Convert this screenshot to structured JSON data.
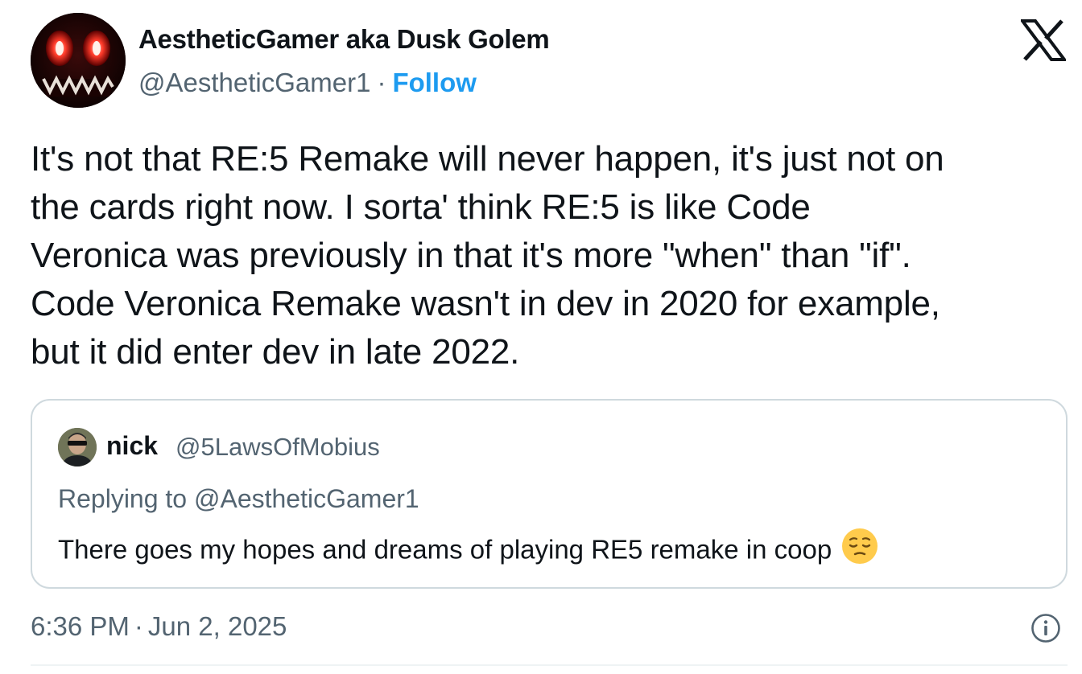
{
  "author": {
    "display_name": "AestheticGamer aka Dusk Golem",
    "handle": "@AestheticGamer1",
    "separator": "·",
    "follow_label": "Follow",
    "avatar_icon": "demon-face-avatar"
  },
  "platform_icon": "x-logo-icon",
  "tweet": {
    "text": "It's not that RE:5 Remake will never happen, it's just not on\nthe cards right now. I sorta' think RE:5 is like Code\nVeronica was previously in that it's more \"when\" than \"if\".\nCode Veronica Remake wasn't in dev in 2020 for example,\nbut it did enter dev in late 2022."
  },
  "quoted_tweet": {
    "display_name": "nick",
    "handle": "@5LawsOfMobius",
    "replying_to": "Replying to @AestheticGamer1",
    "text": "There goes my hopes and dreams of playing RE5 remake in coop",
    "emoji_icon": "pensive-face-emoji"
  },
  "footer": {
    "time": "6:36 PM",
    "separator": "·",
    "date": "Jun 2, 2025",
    "info_icon": "info-circle-icon"
  },
  "colors": {
    "text_primary": "#0f1419",
    "text_secondary": "#536471",
    "accent": "#1d9bf0",
    "border": "#cfd9de"
  }
}
